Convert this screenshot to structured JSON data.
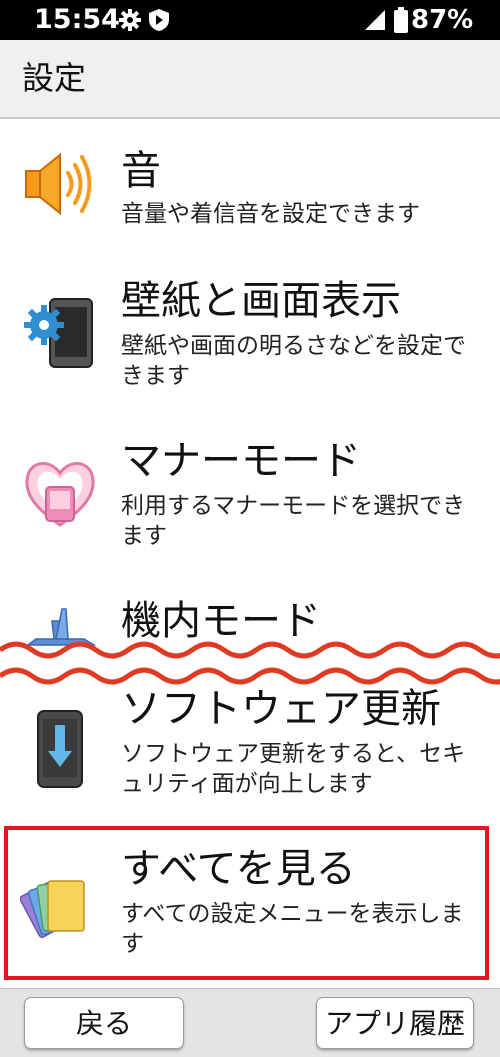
{
  "status_bar": {
    "time": "15:54",
    "battery": "87%",
    "icons": [
      "gear-icon",
      "shield-icon",
      "signal-icon",
      "battery-icon"
    ]
  },
  "header": {
    "title": "設定"
  },
  "items": [
    {
      "title": "音",
      "desc": "音量や着信音を設定できます",
      "icon": "speaker-icon"
    },
    {
      "title": "壁紙と画面表示",
      "desc": "壁紙や画面の明るさなどを設定できます",
      "icon": "wallpaper-display-icon"
    },
    {
      "title": "マナーモード",
      "desc": "利用するマナーモードを選択できます",
      "icon": "manner-mode-icon"
    },
    {
      "title": "機内モード",
      "desc": "",
      "icon": "airplane-icon"
    },
    {
      "title": "ソフトウェア更新",
      "desc": "ソフトウェア更新をすると、セキュリティ面が向上します",
      "icon": "software-update-icon"
    },
    {
      "title": "すべてを見る",
      "desc": "すべての設定メニューを表示します",
      "icon": "cards-icon"
    }
  ],
  "bottom_bar": {
    "back_label": "戻る",
    "history_label": "アプリ履歴"
  },
  "colors": {
    "highlight": "#e8141d",
    "wave": "#e03a22",
    "status_bar": "#000000"
  }
}
